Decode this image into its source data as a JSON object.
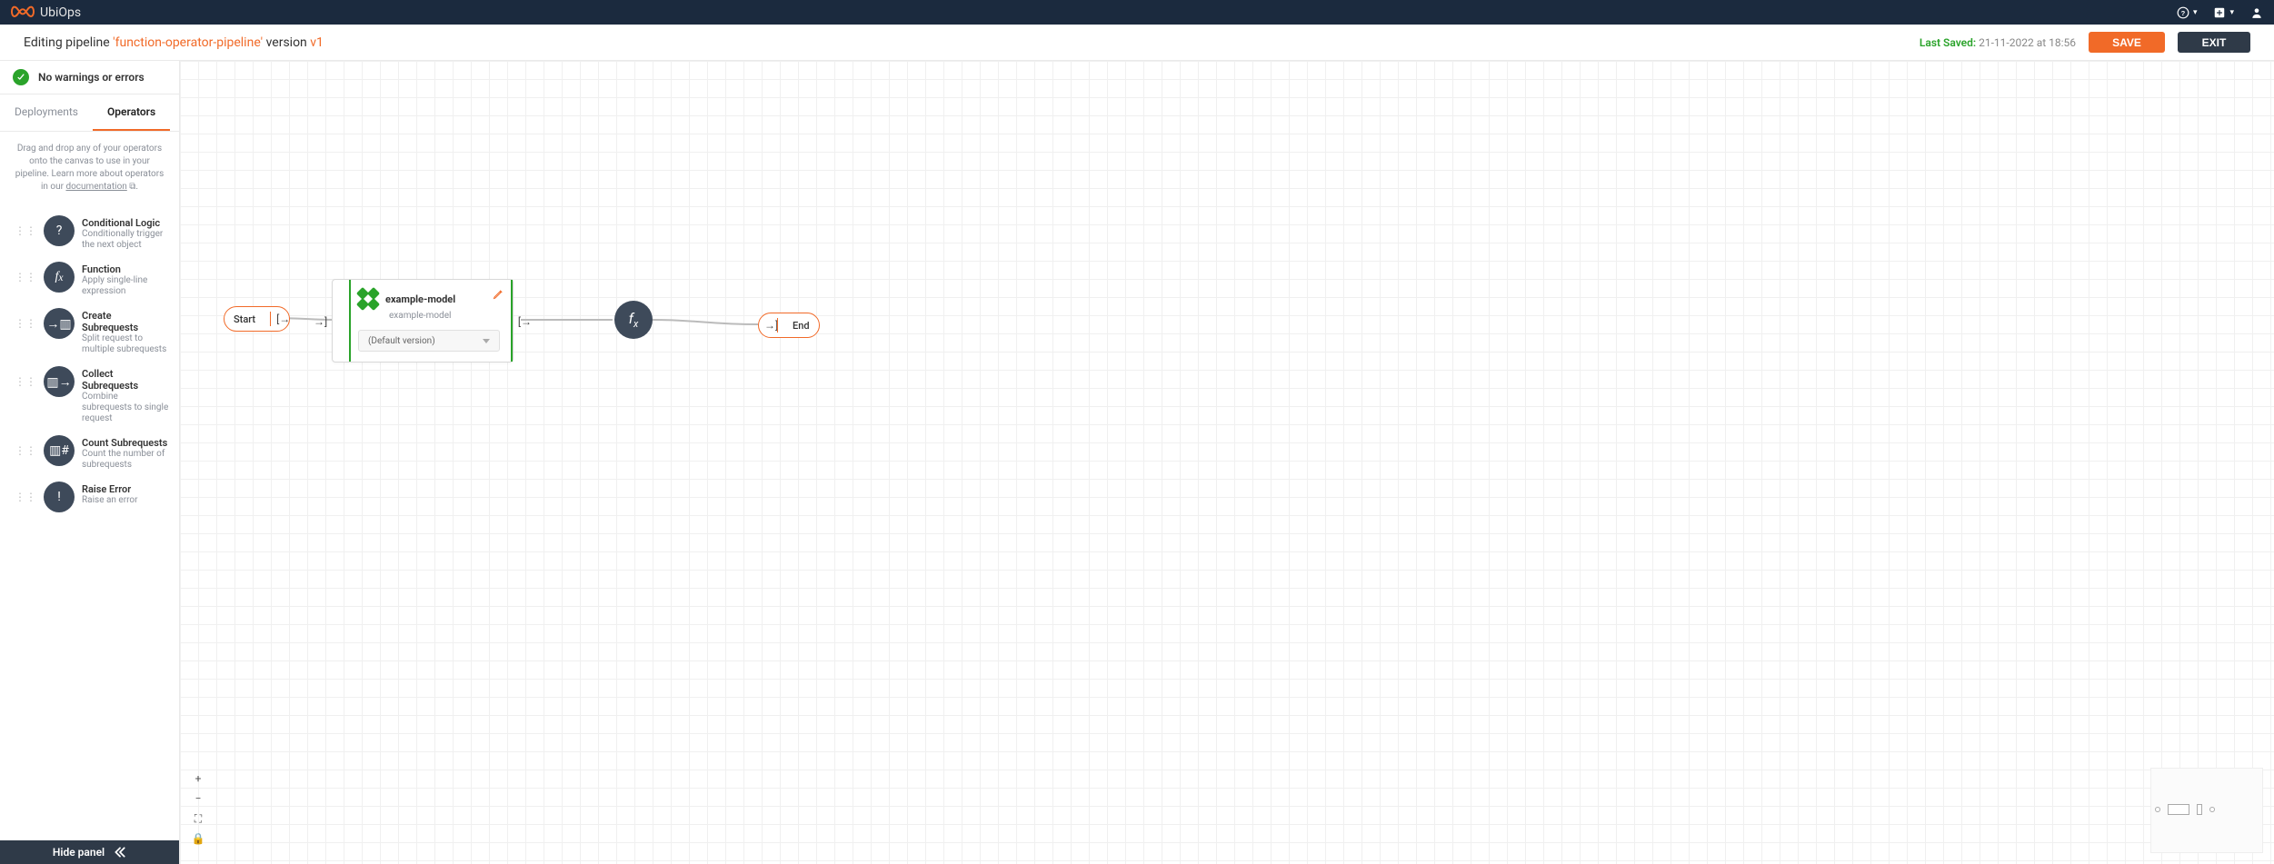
{
  "brand": {
    "name": "UbiOps"
  },
  "header": {
    "prefix": "Editing pipeline ",
    "pipeline_name": "'function-operator-pipeline'",
    "version_label": " version ",
    "version_name": "v1",
    "last_saved_label": "Last Saved:",
    "last_saved_time": "21-11-2022 at 18:56",
    "save_label": "SAVE",
    "exit_label": "EXIT"
  },
  "sidebar": {
    "status_text": "No warnings or errors",
    "tabs": {
      "deployments": "Deployments",
      "operators": "Operators"
    },
    "helptext_a": "Drag and drop any of your operators onto the canvas to use in your pipeline. Learn more about operators in our ",
    "helptext_link": "documentation",
    "operators": [
      {
        "icon": "?",
        "title": "Conditional Logic",
        "desc": "Conditionally trigger the next object"
      },
      {
        "icon": "fx",
        "title": "Function",
        "desc": "Apply single-line expression"
      },
      {
        "icon": "→▥",
        "title": "Create Subrequests",
        "desc": "Split request to multiple subrequests"
      },
      {
        "icon": "▥→",
        "title": "Collect Subrequests",
        "desc": "Combine subrequests to single request"
      },
      {
        "icon": "▥#",
        "title": "Count Subrequests",
        "desc": "Count the number of subrequests"
      },
      {
        "icon": "!",
        "title": "Raise Error",
        "desc": "Raise an error"
      }
    ],
    "hide_panel": "Hide panel"
  },
  "canvas": {
    "start_label": "Start",
    "end_label": "End",
    "model": {
      "title": "example-model",
      "subtitle": "example-model",
      "version": "(Default version)"
    },
    "fx_label": "fx"
  }
}
